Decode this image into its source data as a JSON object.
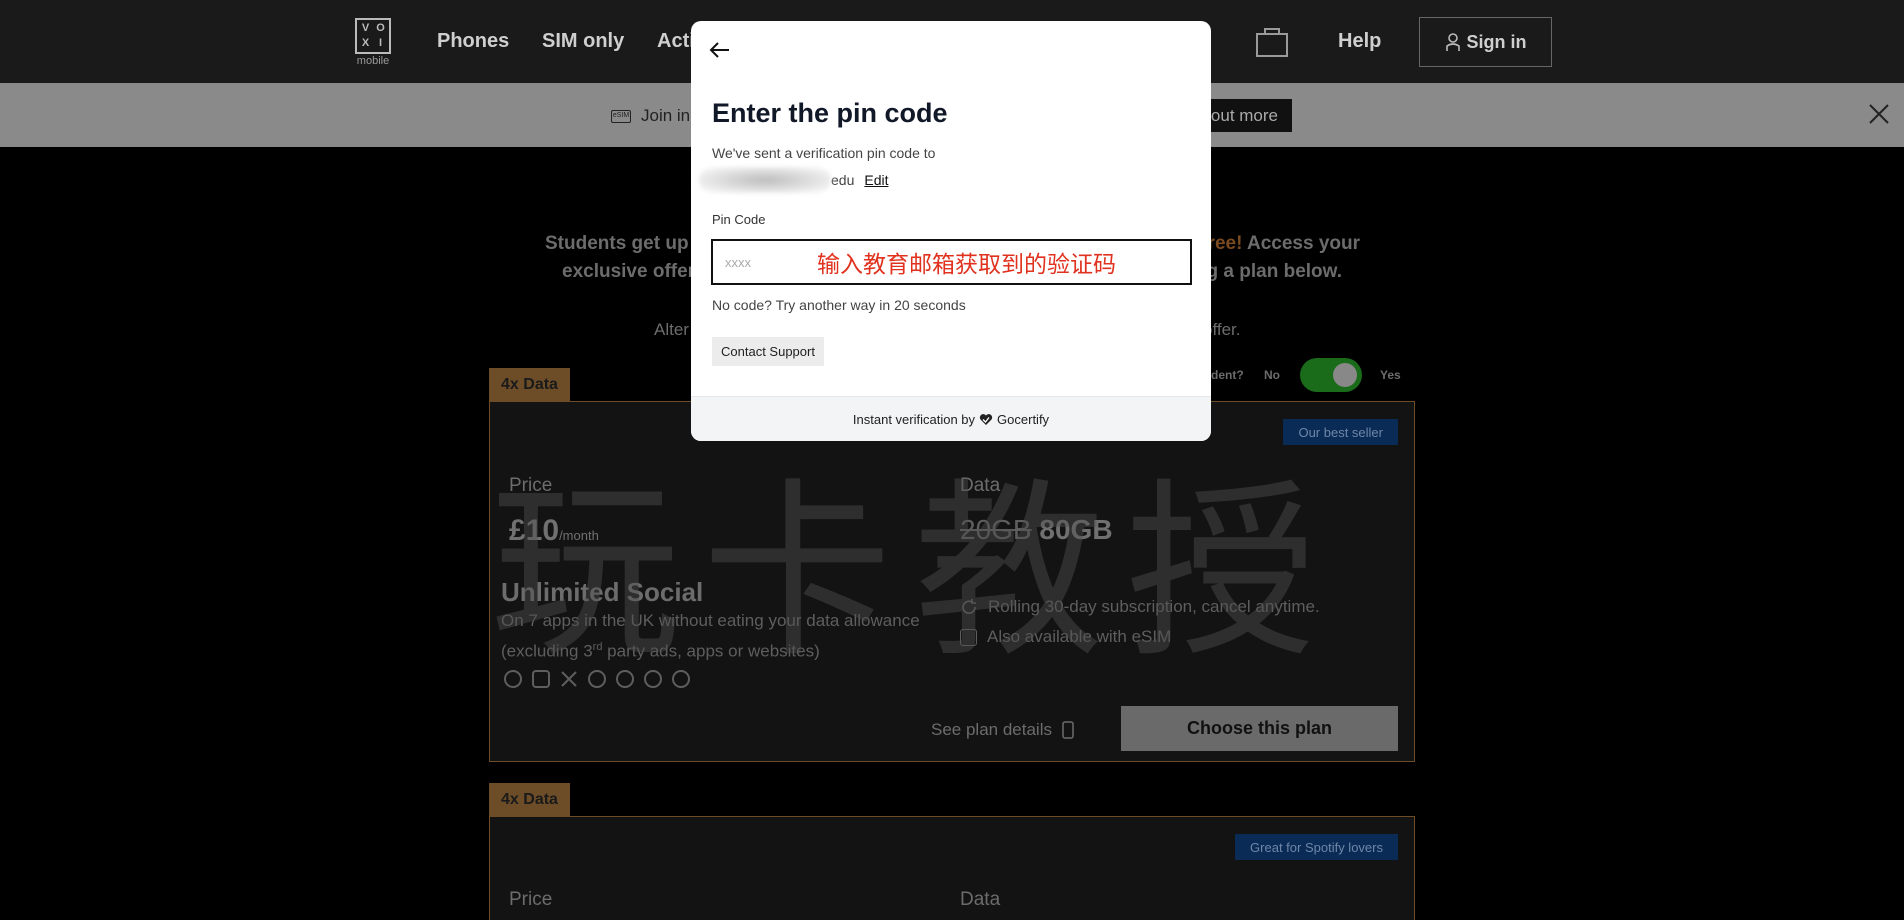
{
  "nav": {
    "logo_letters": [
      "V",
      "O",
      "X",
      "I"
    ],
    "logo_sub": "mobile",
    "links": [
      "Phones",
      "SIM only",
      "Acti"
    ],
    "help": "Help",
    "sign_in": "Sign in"
  },
  "banner": {
    "esim_icon_text": "eSIM",
    "text": "Join in",
    "button": "out more"
  },
  "promo": {
    "line1_start": "Students get up t",
    "line1_hl": "free!",
    "line1_end": " Access your",
    "line2_start": "exclusive offer",
    "line2_end": "g a plan below.",
    "alt_start": "Alter",
    "alt_end": "offer.",
    "student_q": "dent?",
    "no": "No",
    "yes": "Yes"
  },
  "cards": [
    {
      "tab": "4x Data",
      "badge": "Our best seller",
      "price_label": "Price",
      "price": "£10",
      "per": "/month",
      "data_label": "Data",
      "data_old": "20GB",
      "data_new": "80GB",
      "plan_title": "Unlimited Social",
      "desc_1": "On 7 apps in the UK without eating your data allowance",
      "desc_2": "(excluding 3",
      "desc_sup": "rd",
      "desc_3": " party ads, apps or websites)",
      "feature_1": "Rolling 30-day subscription, cancel anytime.",
      "feature_2": "Also available with eSIM",
      "see_details": "See plan details",
      "choose": "Choose this plan"
    },
    {
      "tab": "4x Data",
      "badge": "Great for Spotify lovers",
      "price_label": "Price",
      "data_label": "Data"
    }
  ],
  "watermark": "玩卡教授",
  "modal": {
    "title": "Enter the pin code",
    "sent_text": "We've sent a verification pin code to",
    "email_suffix": "edu",
    "edit": "Edit",
    "pin_label": "Pin Code",
    "pin_placeholder": "xxxx",
    "pin_value": "",
    "annotation": "输入教育邮箱获取到的验证码",
    "no_code": "No code? Try another way in 20 seconds",
    "contact_support": "Contact Support",
    "footer_prefix": "Instant verification by",
    "footer_brand": "Gocertify"
  },
  "colors": {
    "accent_bronze": "#6d4d28",
    "badge_blue": "#0a2b55",
    "annotation_red": "#e0321e",
    "toggle_green": "#1a6b1a"
  }
}
